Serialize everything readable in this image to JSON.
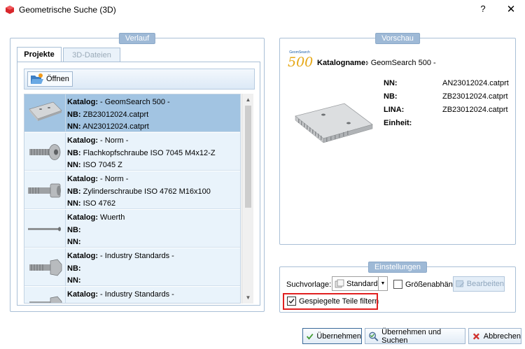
{
  "window": {
    "title": "Geometrische Suche (3D)",
    "help_symbol": "?",
    "close_symbol": "✕"
  },
  "history_panel": {
    "title": "Verlauf",
    "tabs": [
      {
        "label": "Projekte",
        "active": true
      },
      {
        "label": "3D-Dateien",
        "active": false
      }
    ],
    "open_button_label": "Öffnen",
    "items": [
      {
        "katalog_label": "Katalog:",
        "katalog": " - GeomSearch 500 -",
        "nb_label": "NB:",
        "nb": " ZB23012024.catprt",
        "nn_label": "NN:",
        "nn": " AN23012024.catprt",
        "thumb": "plate-icon",
        "selected": true
      },
      {
        "katalog_label": "Katalog:",
        "katalog": " - Norm -",
        "nb_label": "NB:",
        "nb": " Flachkopfschraube ISO 7045 M4x12-Z",
        "nn_label": "NN:",
        "nn": " ISO 7045 Z",
        "thumb": "screw-icon",
        "selected": false
      },
      {
        "katalog_label": "Katalog:",
        "katalog": " - Norm -",
        "nb_label": "NB:",
        "nb": " Zylinderschraube ISO 4762 M16x100",
        "nn_label": "NN:",
        "nn": " ISO 4762",
        "thumb": "screw-icon",
        "selected": false
      },
      {
        "katalog_label": "Katalog:",
        "katalog": " Wuerth",
        "nb_label": "NB:",
        "nb": "",
        "nn_label": "NN:",
        "nn": "",
        "thumb": "pin-icon",
        "selected": false
      },
      {
        "katalog_label": "Katalog:",
        "katalog": " - Industry Standards -",
        "nb_label": "NB:",
        "nb": "",
        "nn_label": "NN:",
        "nn": "",
        "thumb": "bolt-icon",
        "selected": false
      },
      {
        "katalog_label": "Katalog:",
        "katalog": " - Industry Standards -",
        "nb_label": "",
        "nb": "",
        "nn_label": "",
        "nn": "",
        "thumb": "bolt-icon",
        "selected": false
      }
    ]
  },
  "preview_panel": {
    "title": "Vorschau",
    "logo_brand": "GeomSearch",
    "logo_number": "500",
    "catalog_label": "Katalogname:",
    "catalog_value": "- GeomSearch 500 -",
    "properties": [
      {
        "label": "NN:",
        "value": "AN23012024.catprt"
      },
      {
        "label": "NB:",
        "value": "ZB23012024.catprt"
      },
      {
        "label": "LINA:",
        "value": "ZB23012024.catprt"
      },
      {
        "label": "Einheit:",
        "value": ""
      }
    ]
  },
  "settings_panel": {
    "title": "Einstellungen",
    "search_template_label": "Suchvorlage:",
    "search_template_value": "Standard",
    "size_dependent_label": "Größenabhän",
    "size_dependent_checked": false,
    "edit_button_label": "Bearbeiten",
    "mirrored_filter_label": "Gespiegelte Teile filtern",
    "mirrored_filter_checked": true
  },
  "footer": {
    "apply_label": "Übernehmen",
    "apply_search_label": "Übernehmen und Suchen",
    "cancel_label": "Abbrechen"
  },
  "colors": {
    "accent": "#9eb9d6",
    "selection": "#a2c4e2",
    "highlight": "#e02020"
  }
}
